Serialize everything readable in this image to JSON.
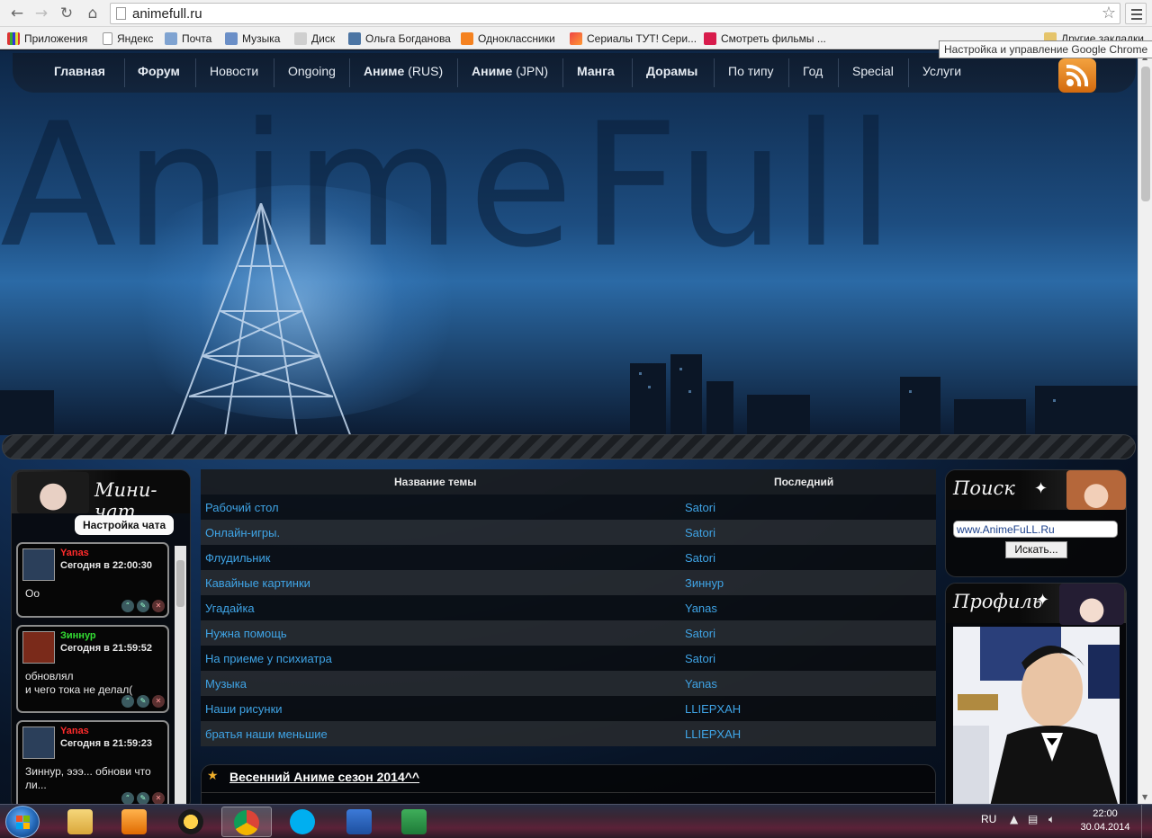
{
  "browser": {
    "url": "animefull.ru",
    "tooltip": "Настройка и управление Google Chrome",
    "bookmarks": [
      {
        "label": "Приложения",
        "color": "#e44"
      },
      {
        "label": "Яндекс",
        "color": "#ffffff"
      },
      {
        "label": "Почта",
        "color": "#7fa3d1"
      },
      {
        "label": "Музыка",
        "color": "#6b8fc7"
      },
      {
        "label": "Диск",
        "color": "#cfcfcf"
      },
      {
        "label": "Ольга Богданова",
        "color": "#4c75a3"
      },
      {
        "label": "Одноклассники",
        "color": "#f58220"
      },
      {
        "label": "Сериалы ТУТ! Сери...",
        "color": "#e44"
      },
      {
        "label": "Смотреть фильмы ...",
        "color": "#d81c4c"
      },
      {
        "label": "Другие закладки",
        "color": "#e5c46b"
      }
    ]
  },
  "site": {
    "logo_text": "AnimeFull",
    "nav": [
      {
        "label": "Главная",
        "bold": true
      },
      {
        "label": "Форум",
        "bold": true
      },
      {
        "label": "Новости",
        "bold": false
      },
      {
        "label": "Ongoing",
        "bold": false
      },
      {
        "label": "Аниме",
        "suffix": " (RUS)",
        "bold": true
      },
      {
        "label": "Аниме",
        "suffix": " (JPN)",
        "bold": true
      },
      {
        "label": "Манга",
        "bold": true
      },
      {
        "label": "Дорамы",
        "bold": true
      },
      {
        "label": "По типу",
        "bold": false
      },
      {
        "label": "Год",
        "bold": false
      },
      {
        "label": "Special",
        "bold": false
      },
      {
        "label": "Услуги",
        "bold": false
      }
    ],
    "minichat": {
      "title": "Мини-чат",
      "settings_label": "Настройка чата",
      "messages": [
        {
          "author": "Yanas",
          "author_color": "#ff2b2b",
          "time": "Сегодня в 22:00:30",
          "text": "Оо"
        },
        {
          "author": "Зиннур",
          "author_color": "#33dd33",
          "time": "Сегодня в 21:59:52",
          "text": "обновлял\nи чего тока не делал("
        },
        {
          "author": "Yanas",
          "author_color": "#ff2b2b",
          "time": "Сегодня в 21:59:23",
          "text": "Зиннур, эээ... обнови что ли..."
        }
      ]
    },
    "forum": {
      "col_topic": "Название темы",
      "col_last": "Последний",
      "rows": [
        {
          "topic": "Рабочий стол",
          "last": "Satori"
        },
        {
          "topic": "Онлайн-игры.",
          "last": "Satori"
        },
        {
          "topic": "Флудильник",
          "last": "Satori"
        },
        {
          "topic": "Кавайные картинки",
          "last": "Зиннур"
        },
        {
          "topic": "Угадайка",
          "last": "Yanas"
        },
        {
          "topic": "Нужна помощь",
          "last": "Satori"
        },
        {
          "topic": "На приеме у психиатра",
          "last": "Satori"
        },
        {
          "topic": "Музыка",
          "last": "Yanas"
        },
        {
          "topic": "Наши рисунки",
          "last": "LLIEPXAH"
        },
        {
          "topic": "братья наши меньшие",
          "last": "LLIEPXAH"
        }
      ]
    },
    "season_title": "Весенний Аниме сезон 2014^^",
    "search": {
      "title": "Поиск",
      "value": "www.AnimeFuLL.Ru",
      "button": "Искать..."
    },
    "profile": {
      "title": "Профиль"
    }
  },
  "taskbar": {
    "lang": "RU",
    "time": "22:00",
    "date": "30.04.2014"
  },
  "colors": {
    "link": "#3fa4e6",
    "accent": "#f1b02c"
  }
}
